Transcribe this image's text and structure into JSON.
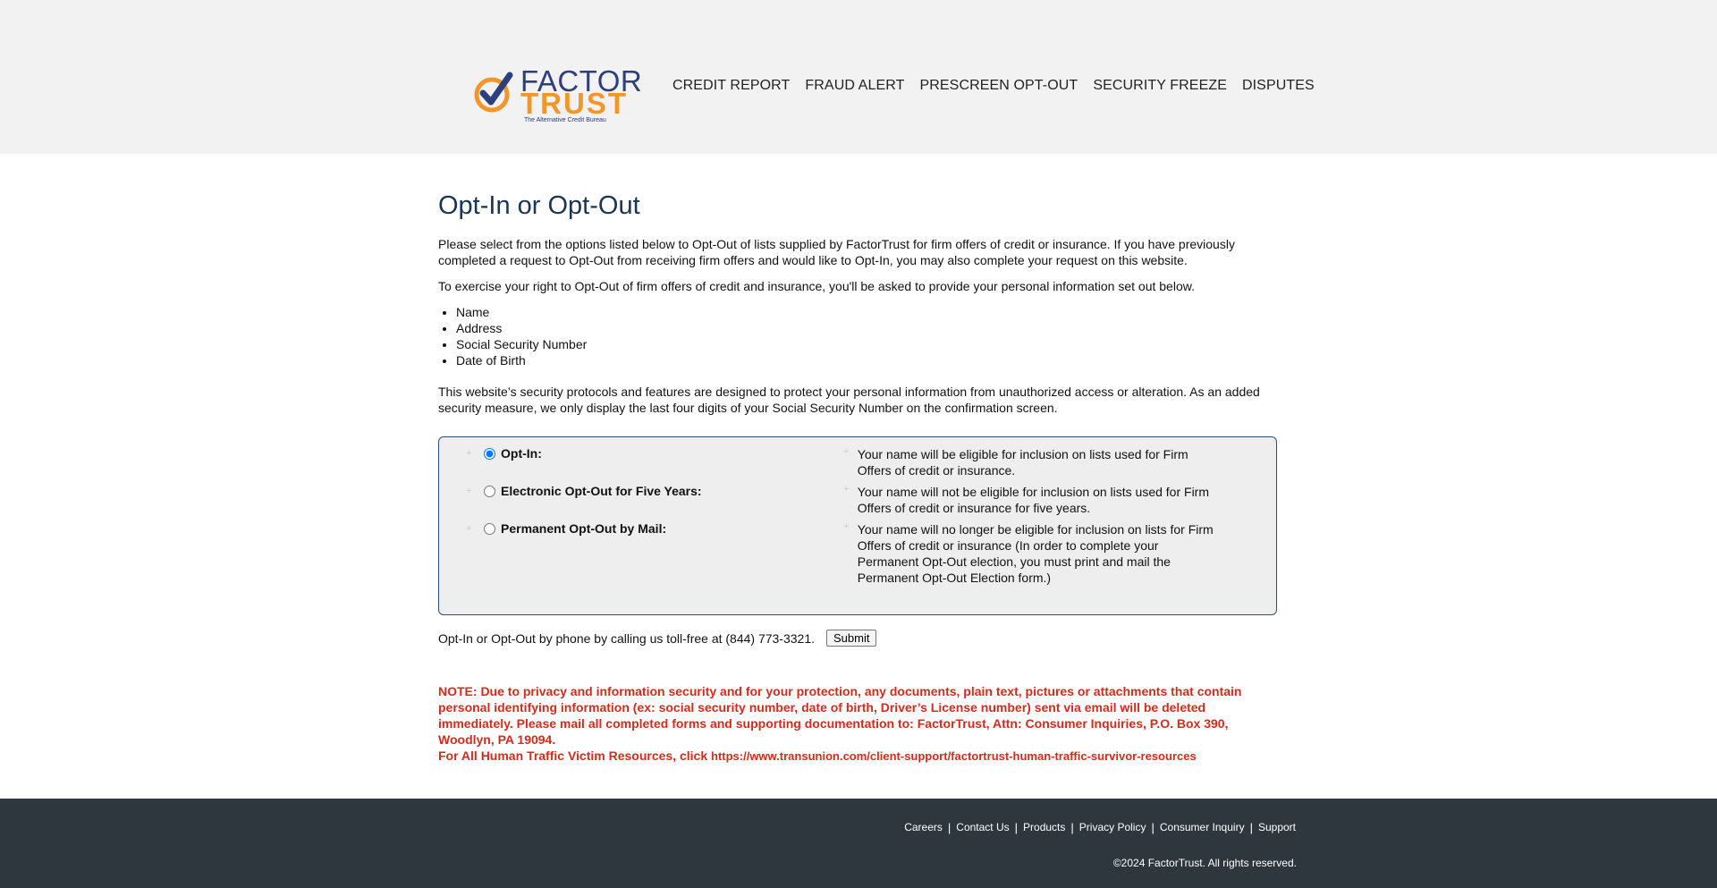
{
  "brand": {
    "name_line1": "FACTOR",
    "name_line2": "TRUST",
    "tagline": "The Alternative Credit Bureau",
    "colors": {
      "navy": "#2d3f7d",
      "orange": "#f0962a",
      "heading": "#1b3554",
      "alert": "#d52b1e",
      "footer": "#2e363e"
    }
  },
  "nav": {
    "items": [
      {
        "label": "CREDIT REPORT"
      },
      {
        "label": "FRAUD ALERT"
      },
      {
        "label": "PRESCREEN OPT-OUT"
      },
      {
        "label": "SECURITY FREEZE"
      },
      {
        "label": "DISPUTES"
      }
    ]
  },
  "main": {
    "title": "Opt-In or Opt-Out",
    "intro1": "Please select from the options listed below to Opt-Out of lists supplied by FactorTrust for firm offers of credit or insurance. If you have previously completed a request to Opt-Out from receiving firm offers and would like to Opt-In, you may also complete your request on this website.",
    "intro2": "To exercise your right to Opt-Out of firm offers of credit and insurance, you'll be asked to provide your personal information set out below.",
    "required_info": [
      "Name",
      "Address",
      "Social Security Number",
      "Date of Birth"
    ],
    "security": "This website’s security protocols and features are designed to protect your personal information from unauthorized access or alteration. As an added security measure, we only display the last four digits of your Social Security Number on the confirmation screen.",
    "options": [
      {
        "label": "Opt-In:",
        "checked": true,
        "description": "Your name will be eligible for inclusion on lists used for Firm Offers of credit or insurance."
      },
      {
        "label": "Electronic Opt-Out for Five Years:",
        "checked": false,
        "description": "Your name will not be eligible for inclusion on lists used for Firm Offers of credit or insurance for five years."
      },
      {
        "label": "Permanent Opt-Out by Mail:",
        "checked": false,
        "description": "Your name will no longer be eligible for inclusion on lists for Firm Offers of credit or insurance (In order to complete your Permanent Opt-Out election, you must print and mail the Permanent Opt-Out Election form.)"
      }
    ],
    "phone_text": "Opt-In or Opt-Out by phone by calling us toll-free at (844) 773-3321.",
    "submit_label": "Submit",
    "note": "NOTE: Due to privacy and information security and for your protection, any documents, plain text, pictures or attachments that contain personal identifying information (ex: social security number, date of birth, Driver’s License number) sent via email will be deleted immediately. Please mail all completed forms and supporting documentation to: FactorTrust, Attn: Consumer Inquiries, P.O. Box 390, Woodlyn, PA 19094.",
    "victim_text": "For All Human Traffic Victim Resources, click",
    "victim_link": "https://www.transunion.com/client-support/factortrust-human-traffic-survivor-resources"
  },
  "footer": {
    "links": [
      {
        "label": "Careers"
      },
      {
        "label": "Contact Us"
      },
      {
        "label": "Products"
      },
      {
        "label": "Privacy Policy"
      },
      {
        "label": "Consumer Inquiry"
      },
      {
        "label": "Support"
      }
    ],
    "separator": "|",
    "copyright": "©2024 FactorTrust. All rights reserved."
  }
}
